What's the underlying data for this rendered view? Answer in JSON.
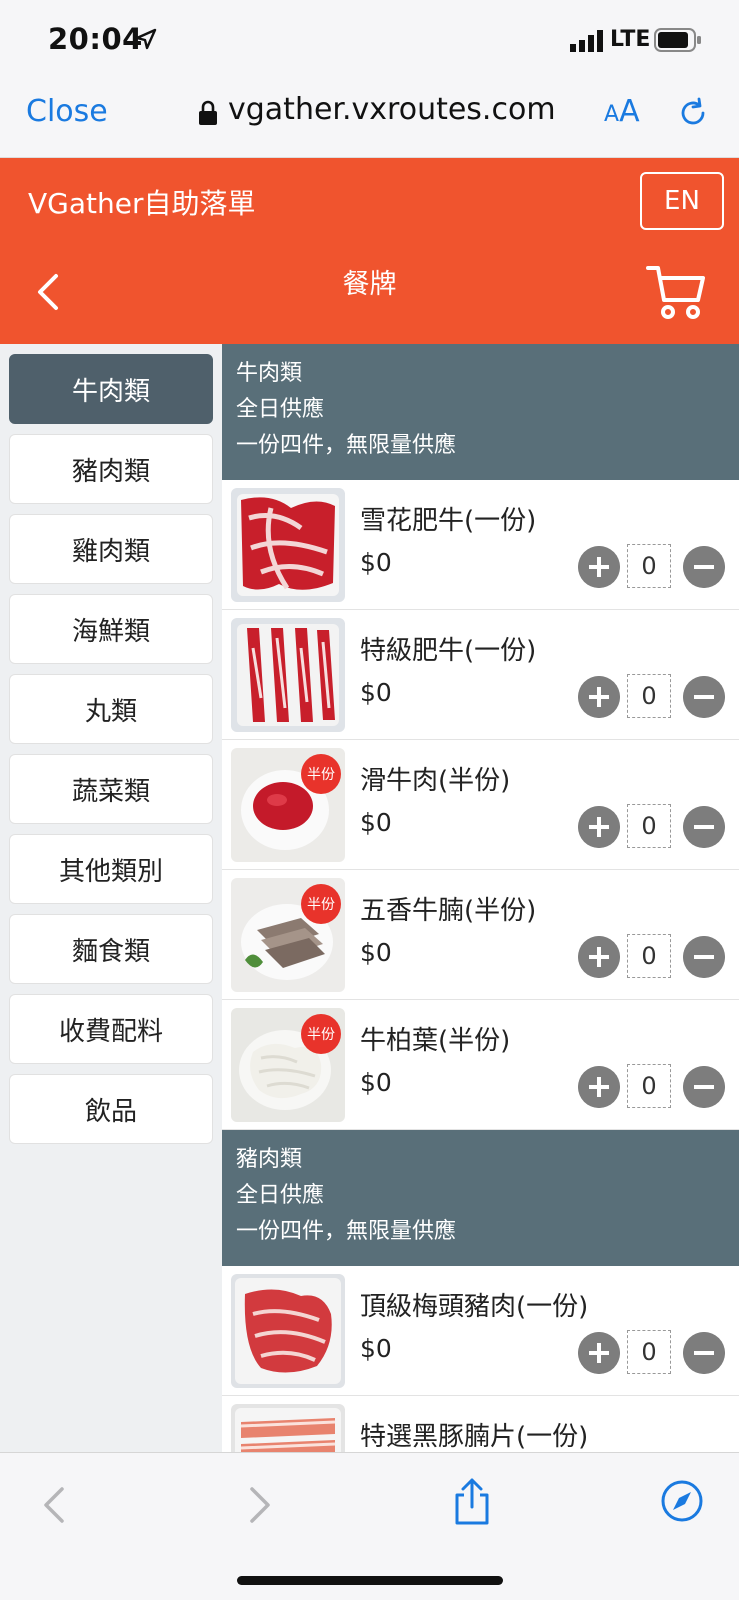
{
  "status": {
    "time": "20:04",
    "network": "LTE"
  },
  "browser": {
    "close_label": "Close",
    "url": "vgather.vxroutes.com",
    "aa_small": "A",
    "aa_big": "A"
  },
  "header": {
    "app_name": "VGather自助落單",
    "lang_button": "EN",
    "title": "餐牌"
  },
  "sidebar": {
    "items": [
      {
        "label": "牛肉類"
      },
      {
        "label": "豬肉類"
      },
      {
        "label": "雞肉類"
      },
      {
        "label": "海鮮類"
      },
      {
        "label": "丸類"
      },
      {
        "label": "蔬菜類"
      },
      {
        "label": "其他類別"
      },
      {
        "label": "麵食類"
      },
      {
        "label": "收費配料"
      },
      {
        "label": "飲品"
      }
    ]
  },
  "sections": [
    {
      "title": "牛肉類",
      "availability": "全日供應",
      "note": "一份四件，無限量供應",
      "items": [
        {
          "name": "雪花肥牛(一份)",
          "price": "$0",
          "qty": "0",
          "badge": ""
        },
        {
          "name": "特級肥牛(一份)",
          "price": "$0",
          "qty": "0",
          "badge": ""
        },
        {
          "name": "滑牛肉(半份)",
          "price": "$0",
          "qty": "0",
          "badge": "半份"
        },
        {
          "name": "五香牛腩(半份)",
          "price": "$0",
          "qty": "0",
          "badge": "半份"
        },
        {
          "name": "牛柏葉(半份)",
          "price": "$0",
          "qty": "0",
          "badge": "半份"
        }
      ]
    },
    {
      "title": "豬肉類",
      "availability": "全日供應",
      "note": "一份四件，無限量供應",
      "items": [
        {
          "name": "頂級梅頭豬肉(一份)",
          "price": "$0",
          "qty": "0",
          "badge": ""
        },
        {
          "name": "特選黑豚腩片(一份)",
          "price": "",
          "qty": "",
          "badge": ""
        }
      ]
    }
  ],
  "colors": {
    "brand": "#f0542e",
    "sidebar_active": "#4f606b",
    "section_header": "#596f79",
    "link": "#1a7ae0"
  },
  "icons": {
    "status": [
      "location-arrow-icon",
      "signal-icon",
      "battery-icon"
    ],
    "browser": [
      "lock-icon",
      "reload-icon"
    ],
    "header": [
      "back-icon",
      "cart-icon"
    ],
    "toolbar": [
      "back-arrow-icon",
      "forward-arrow-icon",
      "share-icon",
      "compass-icon"
    ]
  }
}
